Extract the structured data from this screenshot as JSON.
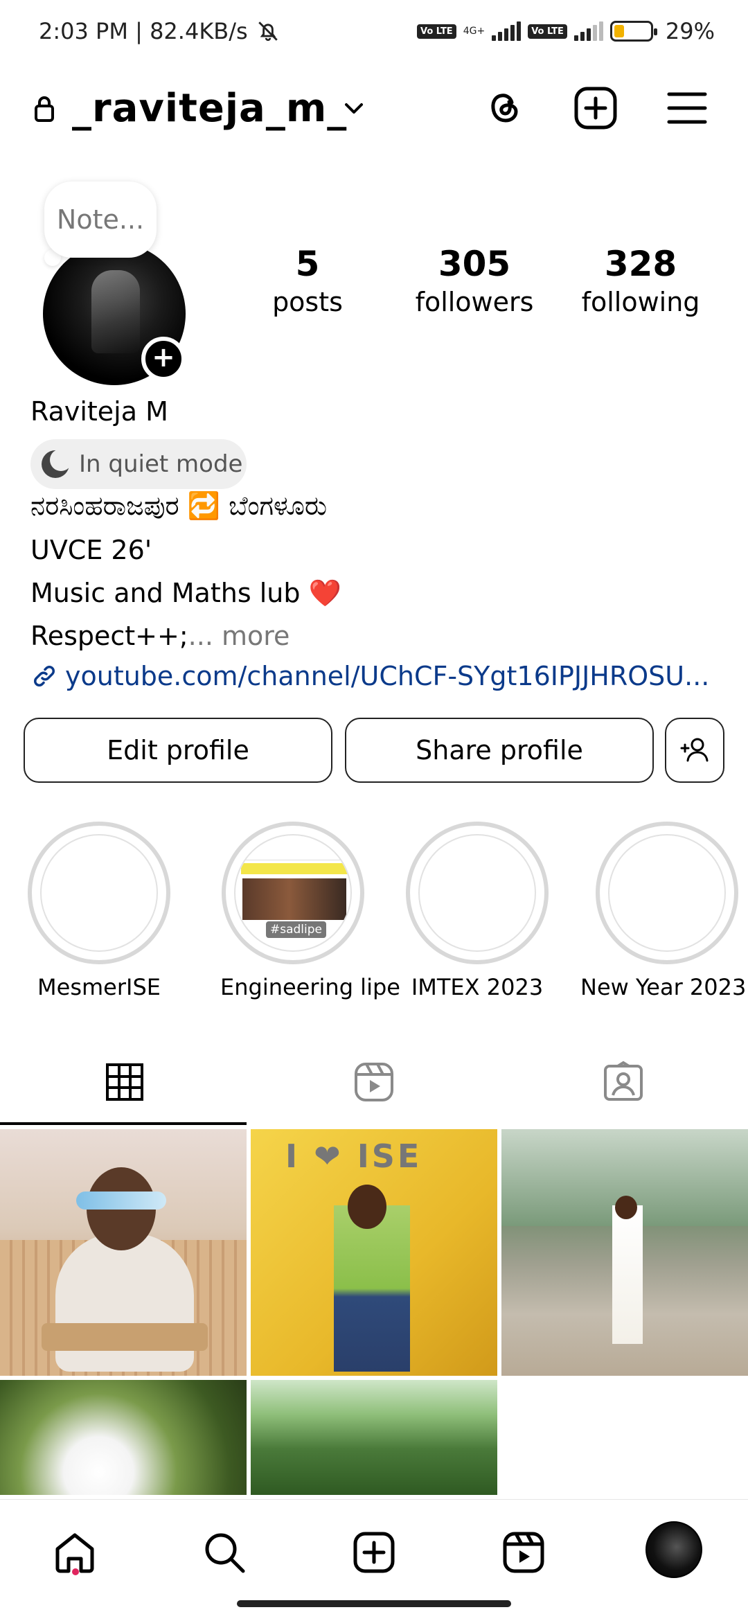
{
  "status_bar": {
    "time_speed": "2:03 PM | 82.4KB/s",
    "network_tag": "4G+",
    "volte_label": "Vo LTE",
    "battery_percent": "29%",
    "battery_level": 0.29
  },
  "header": {
    "username": "_raviteja_m_",
    "icons": [
      "lock-icon",
      "chevron-down-icon",
      "threads-icon",
      "add-post-icon",
      "menu-icon"
    ]
  },
  "profile": {
    "note_placeholder": "Note...",
    "stats": [
      {
        "value": "5",
        "label": "posts"
      },
      {
        "value": "305",
        "label": "followers"
      },
      {
        "value": "328",
        "label": "following"
      }
    ],
    "full_name": "Raviteja M",
    "quiet_mode": "In quiet mode",
    "bio_lines": [
      "ನರಸಿಂಹರಾಜಪುರ 🔁 ಬೆಂಗಳೂರು",
      "UVCE 26'",
      "Music and Maths lub ❤️"
    ],
    "bio_last": "Respect++;",
    "more_label": "... more",
    "link": "youtube.com/channel/UChCF-SYgt16IPJJHROSU..."
  },
  "buttons": {
    "edit": "Edit profile",
    "share": "Share profile"
  },
  "highlights": [
    {
      "label": "MesmerISE"
    },
    {
      "label": "Engineering lipe",
      "badge": "#sadlipe"
    },
    {
      "label": "IMTEX 2023"
    },
    {
      "label": "New Year 2023"
    }
  ],
  "tabs": [
    "grid-icon",
    "reels-icon",
    "tagged-icon"
  ],
  "grid_post_text": {
    "p2_sign": "I ❤ ISE"
  },
  "bottom_nav": [
    "home-icon",
    "search-icon",
    "create-icon",
    "reels-icon",
    "profile-avatar"
  ]
}
